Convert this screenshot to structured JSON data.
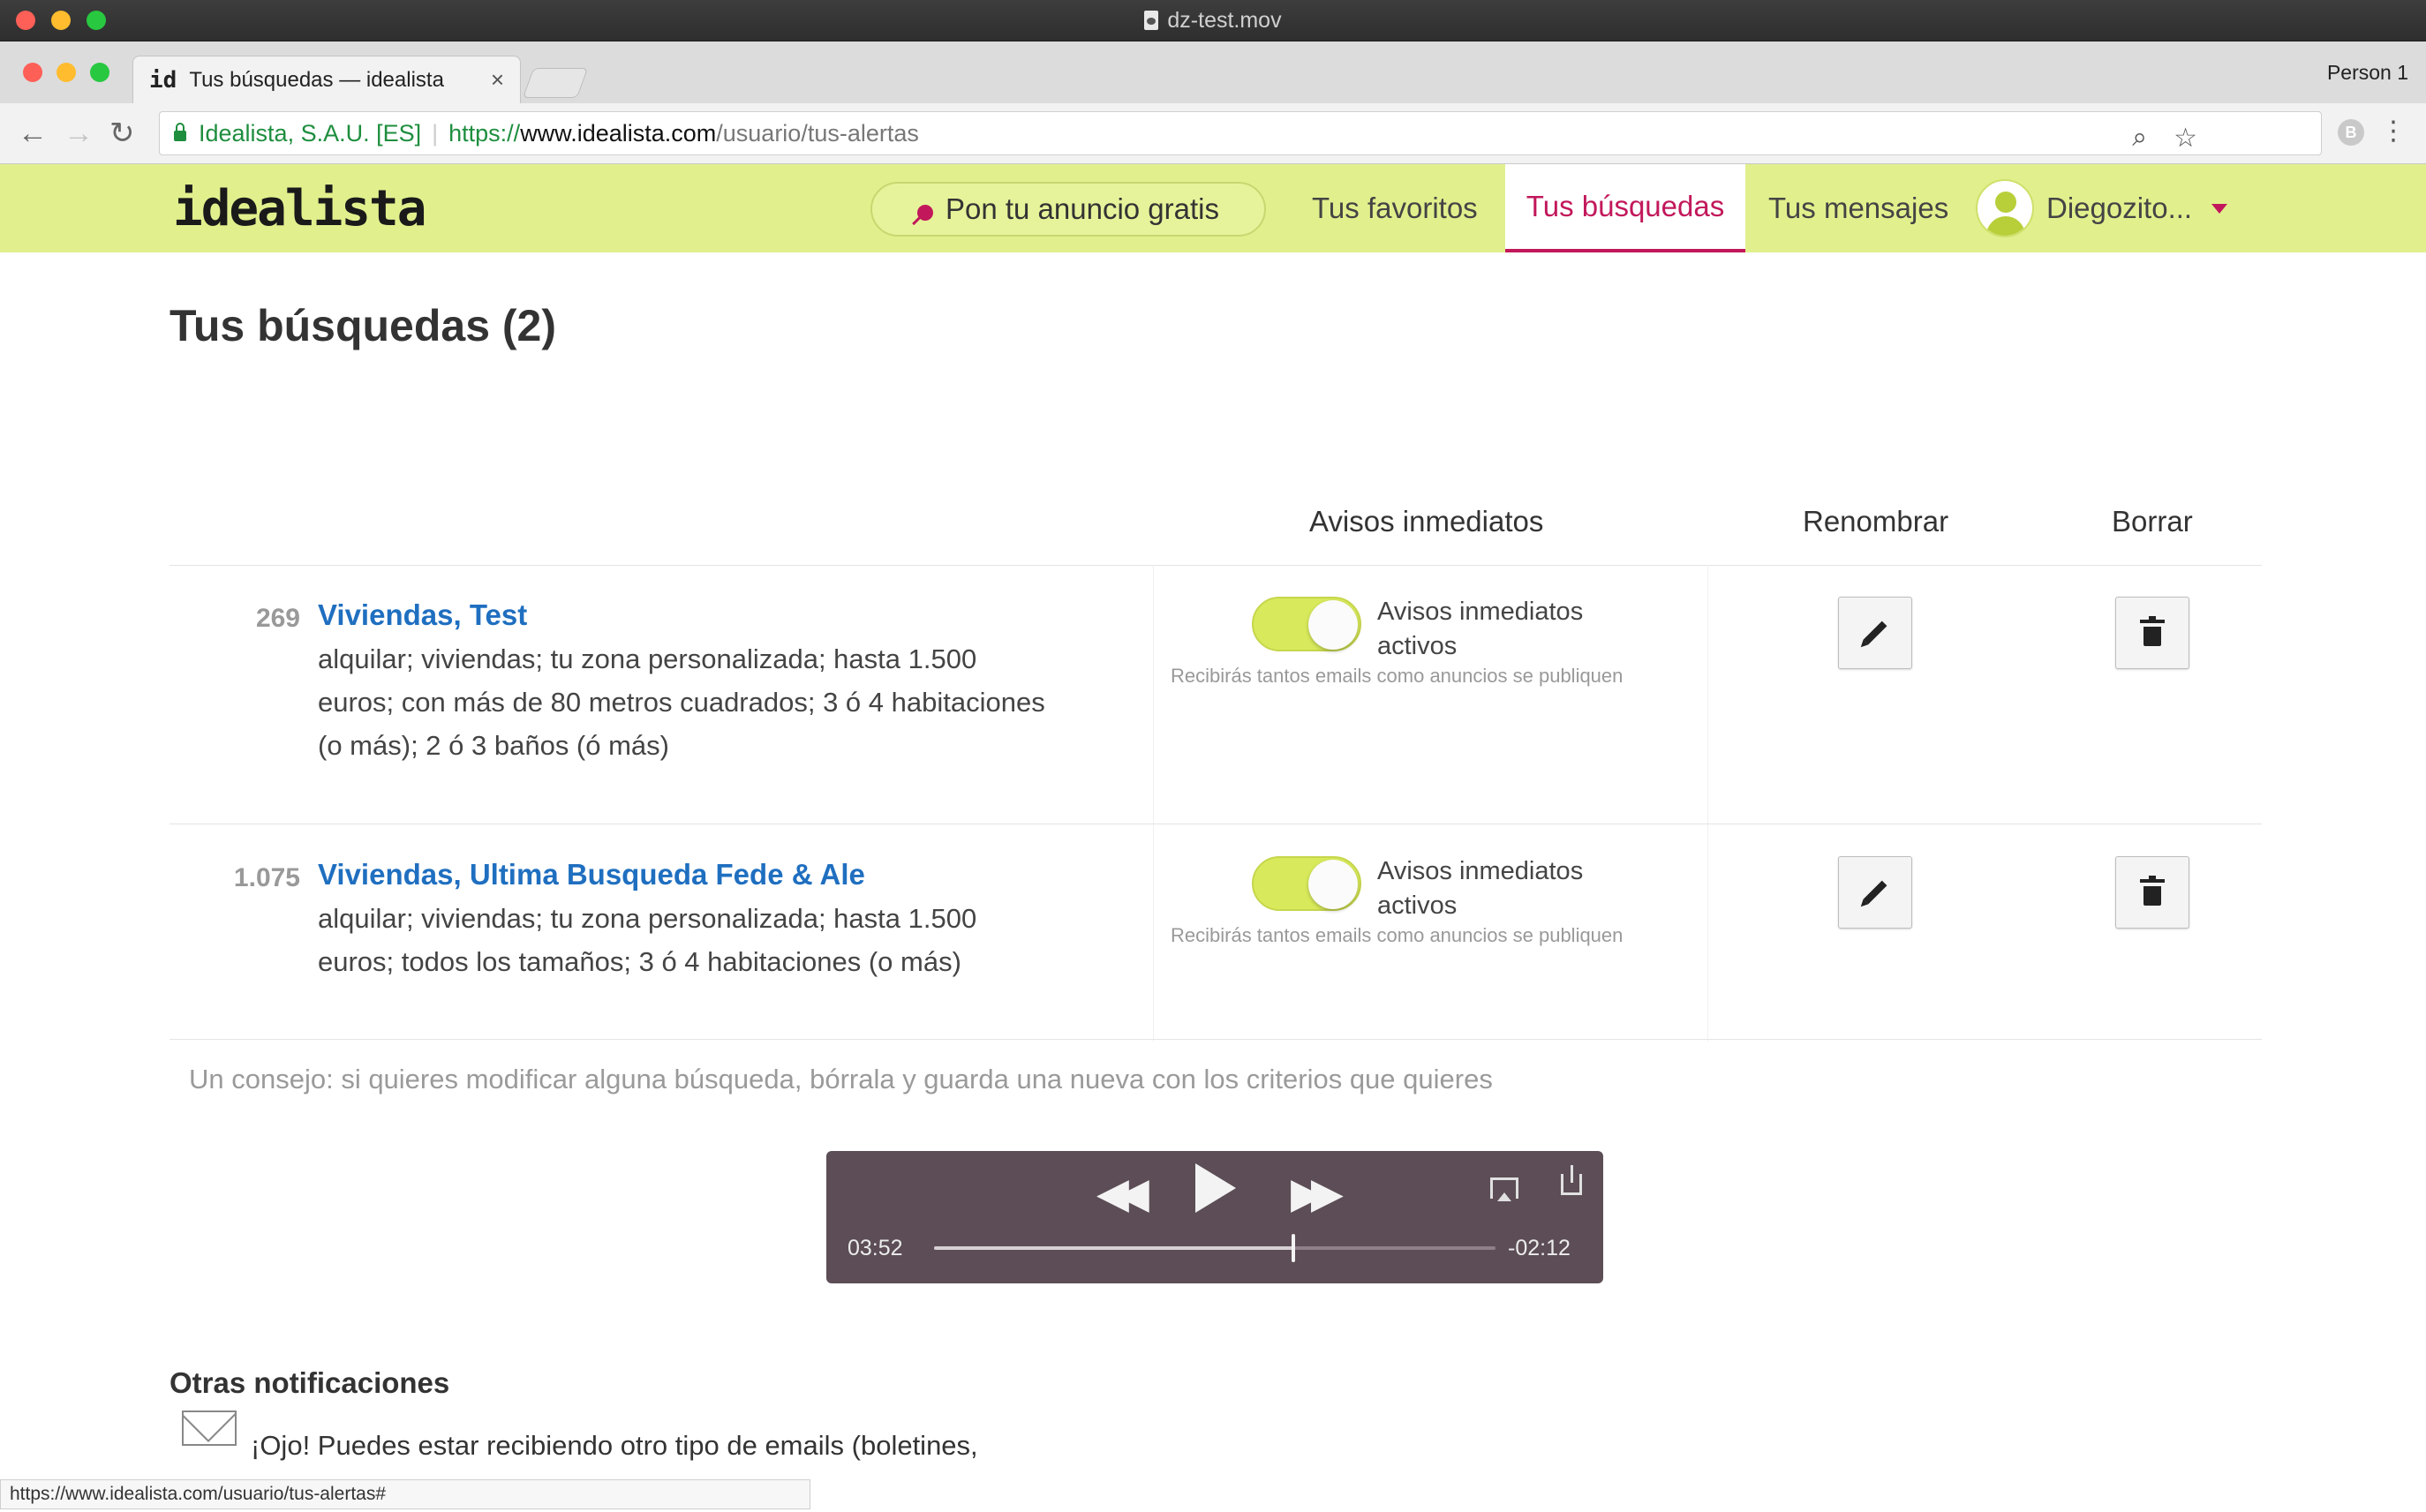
{
  "window": {
    "title": "dz-test.mov",
    "traffic_colors": [
      "#fe5f57",
      "#febc2e",
      "#28c840"
    ]
  },
  "browser": {
    "tab_title": "Tus búsquedas — idealista",
    "tab_favicon": "id",
    "tab_close": "×",
    "profile": "Person 1",
    "site_identity": "Idealista, S.A.U. [ES]",
    "url_scheme": "https://",
    "url_host": "www.idealista.com",
    "url_path": "/usuario/tus-alertas",
    "status_url": "https://www.idealista.com/usuario/tus-alertas#",
    "ext_badge": "B",
    "icons": {
      "back": "←",
      "forward": "→",
      "reload": "↻",
      "zoom": "⌕",
      "bookmark": "☆",
      "menu": "⋮"
    }
  },
  "header": {
    "logo": "idealista",
    "cta": "Pon tu anuncio gratis",
    "nav": [
      "Tus favoritos",
      "Tus búsquedas",
      "Tus mensajes"
    ],
    "user": "Diegozito...",
    "accent": "#c2185b",
    "bg": "#e1f08d"
  },
  "page": {
    "title": "Tus búsquedas (2)",
    "columns": {
      "alerts": "Avisos inmediatos",
      "rename": "Renombrar",
      "delete": "Borrar"
    },
    "searches": [
      {
        "count": "269",
        "title": "Viviendas, Test",
        "desc": "alquilar; viviendas; tu zona personalizada; hasta 1.500 euros; con más de 80 metros cuadrados; 3 ó 4 habitaciones (o más); 2 ó 3 baños (ó más)",
        "toggle_label": "Avisos inmediatos activos",
        "toggle_help": "Recibirás tantos emails como anuncios se publiquen",
        "alerts_on": true
      },
      {
        "count": "1.075",
        "title": "Viviendas, Ultima Busqueda Fede & Ale",
        "desc": "alquilar; viviendas; tu zona personalizada; hasta 1.500 euros; todos los tamaños; 3 ó 4 habitaciones (o más)",
        "toggle_label": "Avisos inmediatos activos",
        "toggle_help": "Recibirás tantos emails como anuncios se publiquen",
        "alerts_on": true
      }
    ],
    "tip": "Un consejo: si quieres modificar alguna búsqueda, bórrala y guarda una nueva con los criterios que quieres",
    "other_title": "Otras notificaciones",
    "other_text": "¡Ojo! Puedes estar recibiendo otro tipo de emails (boletines,"
  },
  "player": {
    "elapsed": "03:52",
    "remaining": "-02:12",
    "progress": 0.64,
    "rewind": "◀◀",
    "fast_forward": "▶▶"
  }
}
